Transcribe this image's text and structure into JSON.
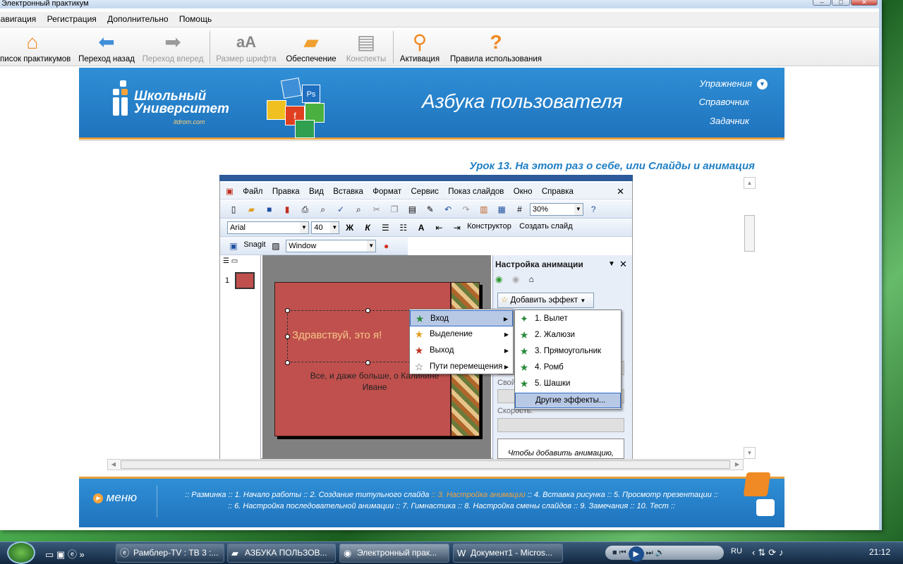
{
  "window": {
    "title": "Электронный практикум"
  },
  "menubar": [
    "Навигация",
    "Регистрация",
    "Дополнительно",
    "Помощь"
  ],
  "toolbar": [
    {
      "label": "Список практикумов",
      "icon": "home-icon",
      "enabled": true
    },
    {
      "label": "Переход назад",
      "icon": "back-arrow-icon",
      "enabled": true
    },
    {
      "label": "Переход вперед",
      "icon": "forward-arrow-icon",
      "enabled": false
    },
    {
      "label": "Размер шрифта",
      "icon": "font-size-icon",
      "enabled": false
    },
    {
      "label": "Обеспечение",
      "icon": "folder-icon",
      "enabled": true
    },
    {
      "label": "Конспекты",
      "icon": "notebook-icon",
      "enabled": false
    },
    {
      "label": "Активация",
      "icon": "key-icon",
      "enabled": true
    },
    {
      "label": "Правила использования",
      "icon": "question-icon",
      "enabled": true
    }
  ],
  "banner": {
    "logo_line1": "Школьный",
    "logo_line2": "Университет",
    "logo_url": "itdrom.com",
    "title": "Азбука пользователя",
    "nav": [
      "Упражнения",
      "Справочник",
      "Задачник"
    ]
  },
  "lesson_title": "Урок 13. На этот раз о себе, или Слайды и анимация",
  "ppt": {
    "menu": [
      "Файл",
      "Правка",
      "Вид",
      "Вставка",
      "Формат",
      "Сервис",
      "Показ слайдов",
      "Окно",
      "Справка"
    ],
    "zoom": "30%",
    "font": "Arial",
    "size": "40",
    "bold": "Ж",
    "italic": "К",
    "designer": "Конструктор",
    "new_slide": "Создать слайд",
    "snagit": "Snagit",
    "capture_mode": "Window",
    "slide_number": "1",
    "slide_title": "Здравствуй, это я!",
    "slide_subtitle": "Все, и даже больше, о Калинине Иване",
    "pane_title": "Настройка анимации",
    "add_effect": "Добавить эффект",
    "label_properties": "Свой",
    "label_speed": "Скорость:",
    "hint": "Чтобы добавить анимацию,",
    "effect_menu": [
      {
        "label": "Вход",
        "highlighted": true
      },
      {
        "label": "Выделение",
        "highlighted": false
      },
      {
        "label": "Выход",
        "highlighted": false
      },
      {
        "label": "Пути перемещения",
        "highlighted": false
      }
    ],
    "entrance_menu": [
      "1. Вылет",
      "2. Жалюзи",
      "3. Прямоугольник",
      "4. Ромб",
      "5. Шашки"
    ],
    "more_effects": "Другие эффекты..."
  },
  "footer": {
    "menu": "меню",
    "line1": [
      ":: Разминка",
      ":: 1. Начало работы",
      ":: 2. Создание титульного слайда",
      ":: 3. Настройка анимации",
      ":: 4. Вставка рисунка",
      ":: 5. Просмотр презентации ::"
    ],
    "line2": [
      ":: 6. Настройка последовательной анимации",
      ":: 7. Гимнастика",
      ":: 8. Настройка смены слайдов",
      ":: 9. Замечания",
      ":: 10. Тест ::"
    ],
    "current": ":: 3. Настройка анимации"
  },
  "taskbar": {
    "items": [
      "Рамблер-TV : ТВ 3 :...",
      "АЗБУКА ПОЛЬЗОВ...",
      "Электронный прак...",
      "Документ1 - Micros..."
    ],
    "active": "Электронный прак...",
    "lang": "RU",
    "clock": "21:12"
  }
}
